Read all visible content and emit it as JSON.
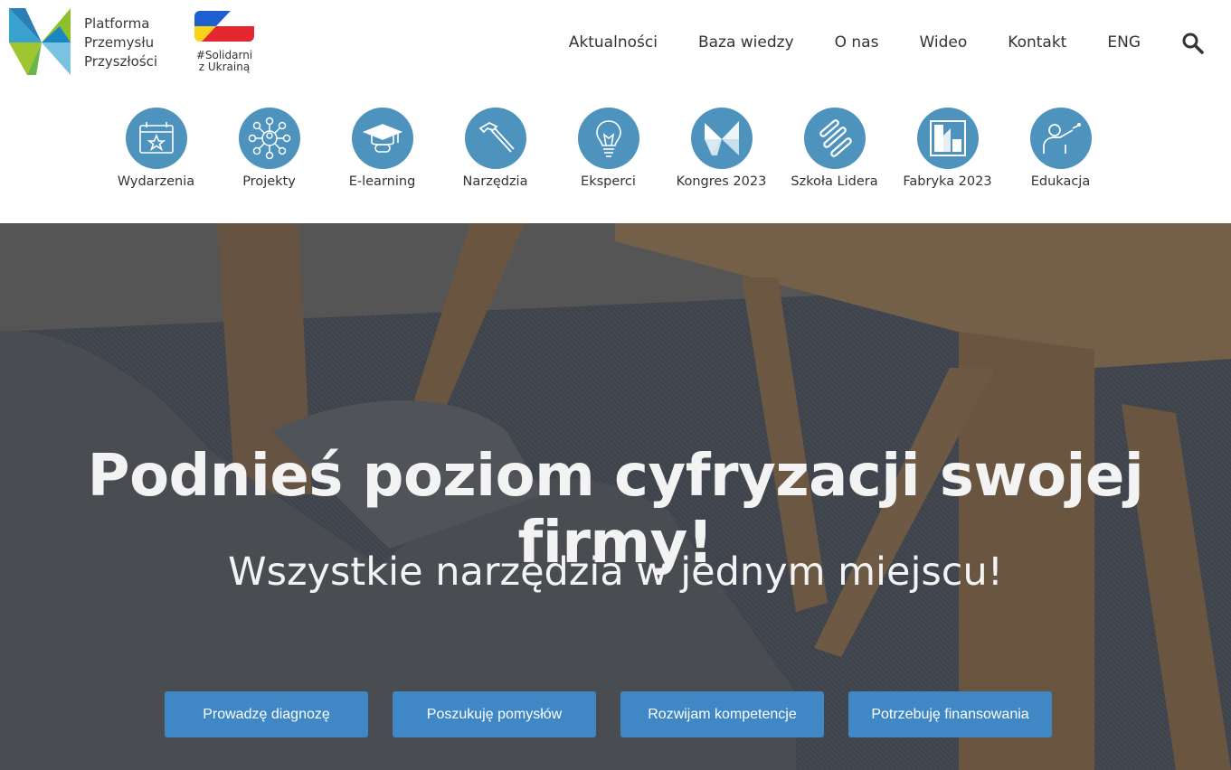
{
  "brand": {
    "line1": "Platforma",
    "line2": "Przemysłu",
    "line3": "Przyszłości"
  },
  "ukraine_badge": {
    "line1": "#Solidarni",
    "line2": "z Ukrainą"
  },
  "nav": {
    "items": [
      {
        "label": "Aktualności"
      },
      {
        "label": "Baza wiedzy"
      },
      {
        "label": "O nas"
      },
      {
        "label": "Wideo"
      },
      {
        "label": "Kontakt"
      },
      {
        "label": "ENG"
      }
    ],
    "search_icon": "search-icon"
  },
  "categories": [
    {
      "label": "Wydarzenia",
      "icon": "calendar-star-icon"
    },
    {
      "label": "Projekty",
      "icon": "network-icon"
    },
    {
      "label": "E-learning",
      "icon": "graduation-cap-icon"
    },
    {
      "label": "Narzędzia",
      "icon": "hammer-icon"
    },
    {
      "label": "Eksperci",
      "icon": "lightbulb-icon"
    },
    {
      "label": "Kongres 2023",
      "icon": "kongres-logo-icon"
    },
    {
      "label": "Szkoła Lidera",
      "icon": "stripes-icon"
    },
    {
      "label": "Fabryka 2023",
      "icon": "fabryka-logo-icon"
    },
    {
      "label": "Edukacja",
      "icon": "teacher-icon"
    }
  ],
  "hero": {
    "title": "Podnieś poziom cyfryzacji swojej firmy!",
    "subtitle": "Wszystkie narzędzia w jednym miejscu!",
    "buttons": [
      {
        "label": "Prowadzę diagnozę"
      },
      {
        "label": "Poszukuję pomysłów"
      },
      {
        "label": "Rozwijam kompetencje"
      },
      {
        "label": "Potrzebuję finansowania"
      }
    ]
  },
  "colors": {
    "accent": "#3f88c5",
    "icon_circle": "#4d93bd",
    "ua_blue": "#1f5fcf",
    "ua_yellow": "#f7d417",
    "pl_red": "#e3262f"
  }
}
